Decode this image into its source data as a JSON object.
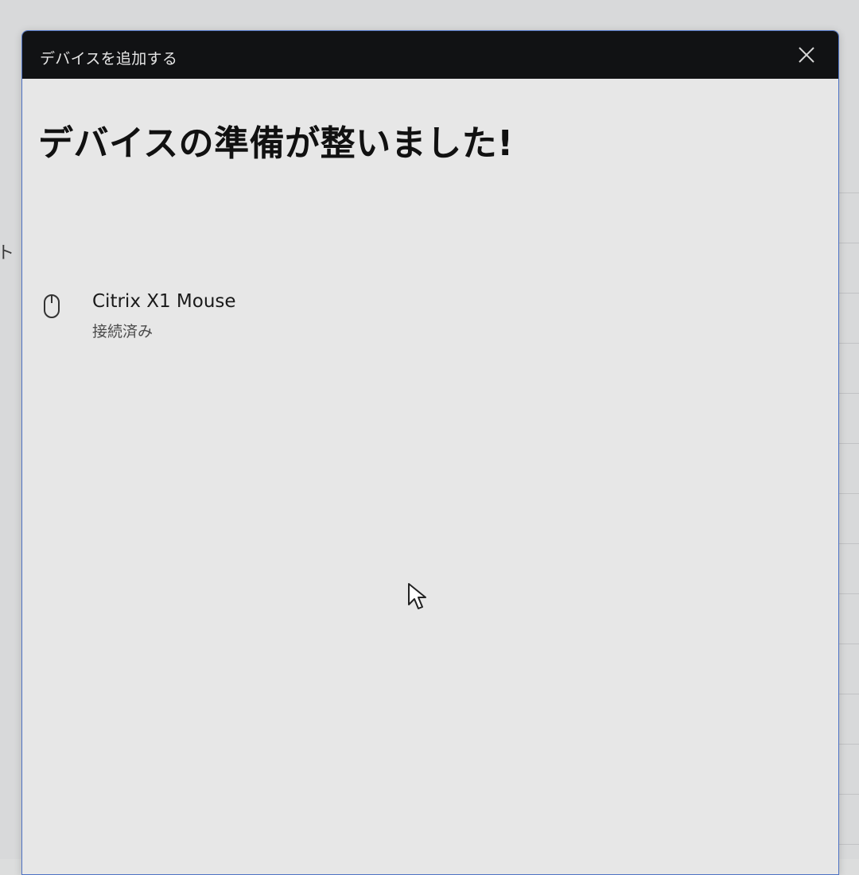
{
  "dialog": {
    "title": "デバイスを追加する",
    "close_icon": "close-icon",
    "heading": "デバイスの準備が整いました!",
    "device": {
      "icon": "mouse-icon",
      "name": "Citrix X1 Mouse",
      "status": "接続済み"
    }
  },
  "backdrop": {
    "left_edge_glyph": "ト"
  },
  "colors": {
    "title_bar": "#111214",
    "dialog_background": "#e7e7e7",
    "dialog_border": "#4f73c4",
    "heading_text": "#111111",
    "secondary_text": "#4a4a4a"
  }
}
